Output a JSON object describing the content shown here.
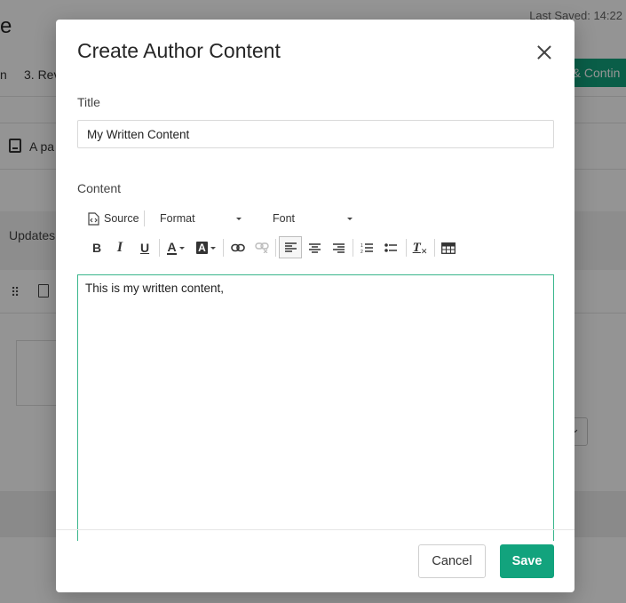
{
  "background": {
    "page_title": "e",
    "last_saved": "Last Saved: 14:22",
    "step_partial_1": "n",
    "step_partial_2": "3. Rev",
    "continue_partial": "e & Contin",
    "row_text": "A pa",
    "updates_label": "Updates",
    "drag_glyph": "⠿"
  },
  "modal": {
    "title": "Create Author Content",
    "title_field": {
      "label": "Title",
      "value": "My Written Content"
    },
    "content_field": {
      "label": "Content"
    },
    "toolbar": {
      "source_label": "Source",
      "format_label": "Format",
      "font_label": "Font",
      "bold": "B",
      "italic": "I",
      "underline": "U",
      "text_color": "A",
      "bg_color": "A",
      "clear_format": "T"
    },
    "editor_text": "This is my written content,",
    "cancel_label": "Cancel",
    "save_label": "Save"
  },
  "colors": {
    "accent": "#12a37d",
    "focus_border": "#39b68c"
  }
}
